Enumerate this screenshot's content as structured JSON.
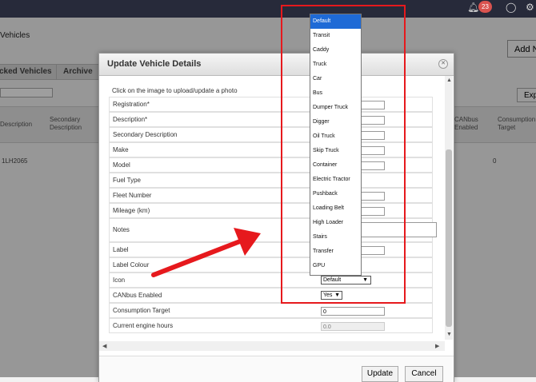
{
  "topbar": {
    "badge": "23"
  },
  "background": {
    "title": "Vehicles",
    "add_button": "Add N",
    "tabs": [
      "cked Vehicles",
      "Archive"
    ],
    "export_button": "Exp",
    "headers": [
      "Description",
      "Secondary Description",
      "CANbus Enabled",
      "Consumption Target"
    ],
    "row": {
      "description": "1LH2065",
      "consumption": "0"
    }
  },
  "dialog": {
    "title": "Update Vehicle Details",
    "photo_text": "Click on the image to upload/update a photo",
    "fields": [
      {
        "label": "Registration*"
      },
      {
        "label": "Description*"
      },
      {
        "label": "Secondary Description"
      },
      {
        "label": "Make"
      },
      {
        "label": "Model"
      },
      {
        "label": "Fuel Type"
      },
      {
        "label": "Fleet Number"
      },
      {
        "label": "Mileage (km)"
      },
      {
        "label": "Notes"
      },
      {
        "label": "Label"
      },
      {
        "label": "Label Colour"
      },
      {
        "label": "Icon",
        "value": "Default"
      },
      {
        "label": "CANbus Enabled",
        "value": "Yes"
      },
      {
        "label": "Consumption Target",
        "value": "0"
      },
      {
        "label": "Current engine hours",
        "value": "0.0"
      }
    ],
    "update_button": "Update",
    "cancel_button": "Cancel"
  },
  "icon_dropdown": {
    "selected": "Default",
    "options": [
      "Default",
      "Transit",
      "Caddy",
      "Truck",
      "Car",
      "Bus",
      "Dumper Truck",
      "Digger",
      "Oil Truck",
      "Skip Truck",
      "Container",
      "Electric Tractor",
      "Pushback",
      "Loading Belt",
      "High Loader",
      "Stairs",
      "Transfer",
      "GPU"
    ]
  },
  "colors": {
    "highlight": "#e6191d",
    "selected_option": "#1e6ad6"
  }
}
